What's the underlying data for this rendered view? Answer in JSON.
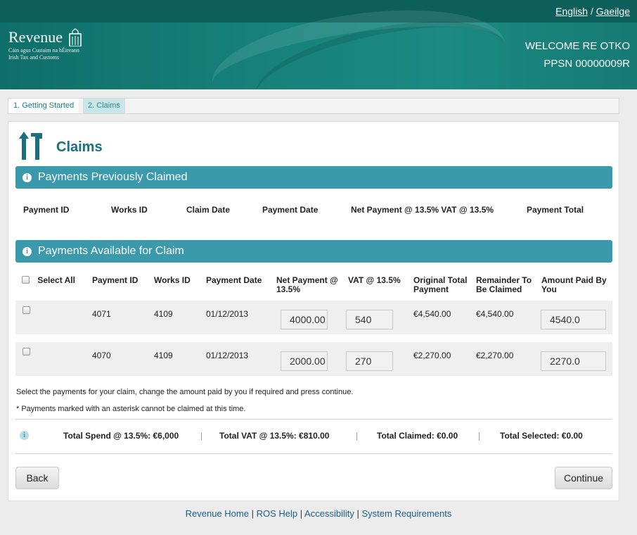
{
  "header": {
    "lang_english": "English",
    "lang_sep": "/",
    "lang_irish": "Gaeilge",
    "welcome": "WELCOME RE OTKO",
    "ppsn": "PPSN 00000009R",
    "logo_title": "Revenue",
    "logo_sub1": "Cáin agus Custaim na hÉireann",
    "logo_sub2": "Irish Tax and Customs"
  },
  "tabs": [
    {
      "label": "1. Getting Started"
    },
    {
      "label": "2. Claims"
    }
  ],
  "page": {
    "title": "Claims"
  },
  "previous": {
    "section_title": "Payments Previously Claimed",
    "columns": [
      "Payment ID",
      "Works ID",
      "Claim Date",
      "Payment Date",
      "Net Payment @ 13.5% VAT @ 13.5%",
      "Payment Total"
    ]
  },
  "available": {
    "section_title": "Payments Available for Claim",
    "select_all": "Select All",
    "columns": {
      "payment_id": "Payment ID",
      "works_id": "Works ID",
      "payment_date": "Payment Date",
      "net_payment_1": "Net Payment @",
      "net_payment_2": "13.5%",
      "vat": "VAT @ 13.5%",
      "original_1": "Original Total",
      "original_2": "Payment",
      "remainder_1": "Remainder To",
      "remainder_2": "Be Claimed",
      "amount_1": "Amount Paid By",
      "amount_2": "You"
    },
    "rows": [
      {
        "payment_id": "4071",
        "works_id": "4109",
        "payment_date": "01/12/2013",
        "net_payment": "4000.00",
        "vat": "540",
        "original_total": "€4,540.00",
        "remainder": "€4,540.00",
        "amount_paid": "4540.0",
        "checked": false
      },
      {
        "payment_id": "4070",
        "works_id": "4109",
        "payment_date": "01/12/2013",
        "net_payment": "2000.00",
        "vat": "270",
        "original_total": "€2,270.00",
        "remainder": "€2,270.00",
        "amount_paid": "2270.0",
        "checked": false
      }
    ]
  },
  "notes": {
    "instruction": "Select the payments for your claim, change the amount paid by you if required and press continue.",
    "asterisk": "* Payments marked with an asterisk cannot be claimed at this time."
  },
  "totals": {
    "spend": "Total Spend @ 13.5%: €6,000",
    "vat": "Total VAT @ 13.5%: €810.00",
    "claimed": "Total Claimed: €0.00",
    "selected": "Total Selected: €0.00",
    "sep": "|"
  },
  "buttons": {
    "back": "Back",
    "continue": "Continue"
  },
  "footer": {
    "home": "Revenue Home",
    "help": "ROS Help",
    "accessibility": "Accessibility",
    "requirements": "System Requirements",
    "sep": "|"
  },
  "colors": {
    "header_teal": "#17807a",
    "section_bar": "#3a9aac",
    "title_blue": "#1a6f80"
  }
}
